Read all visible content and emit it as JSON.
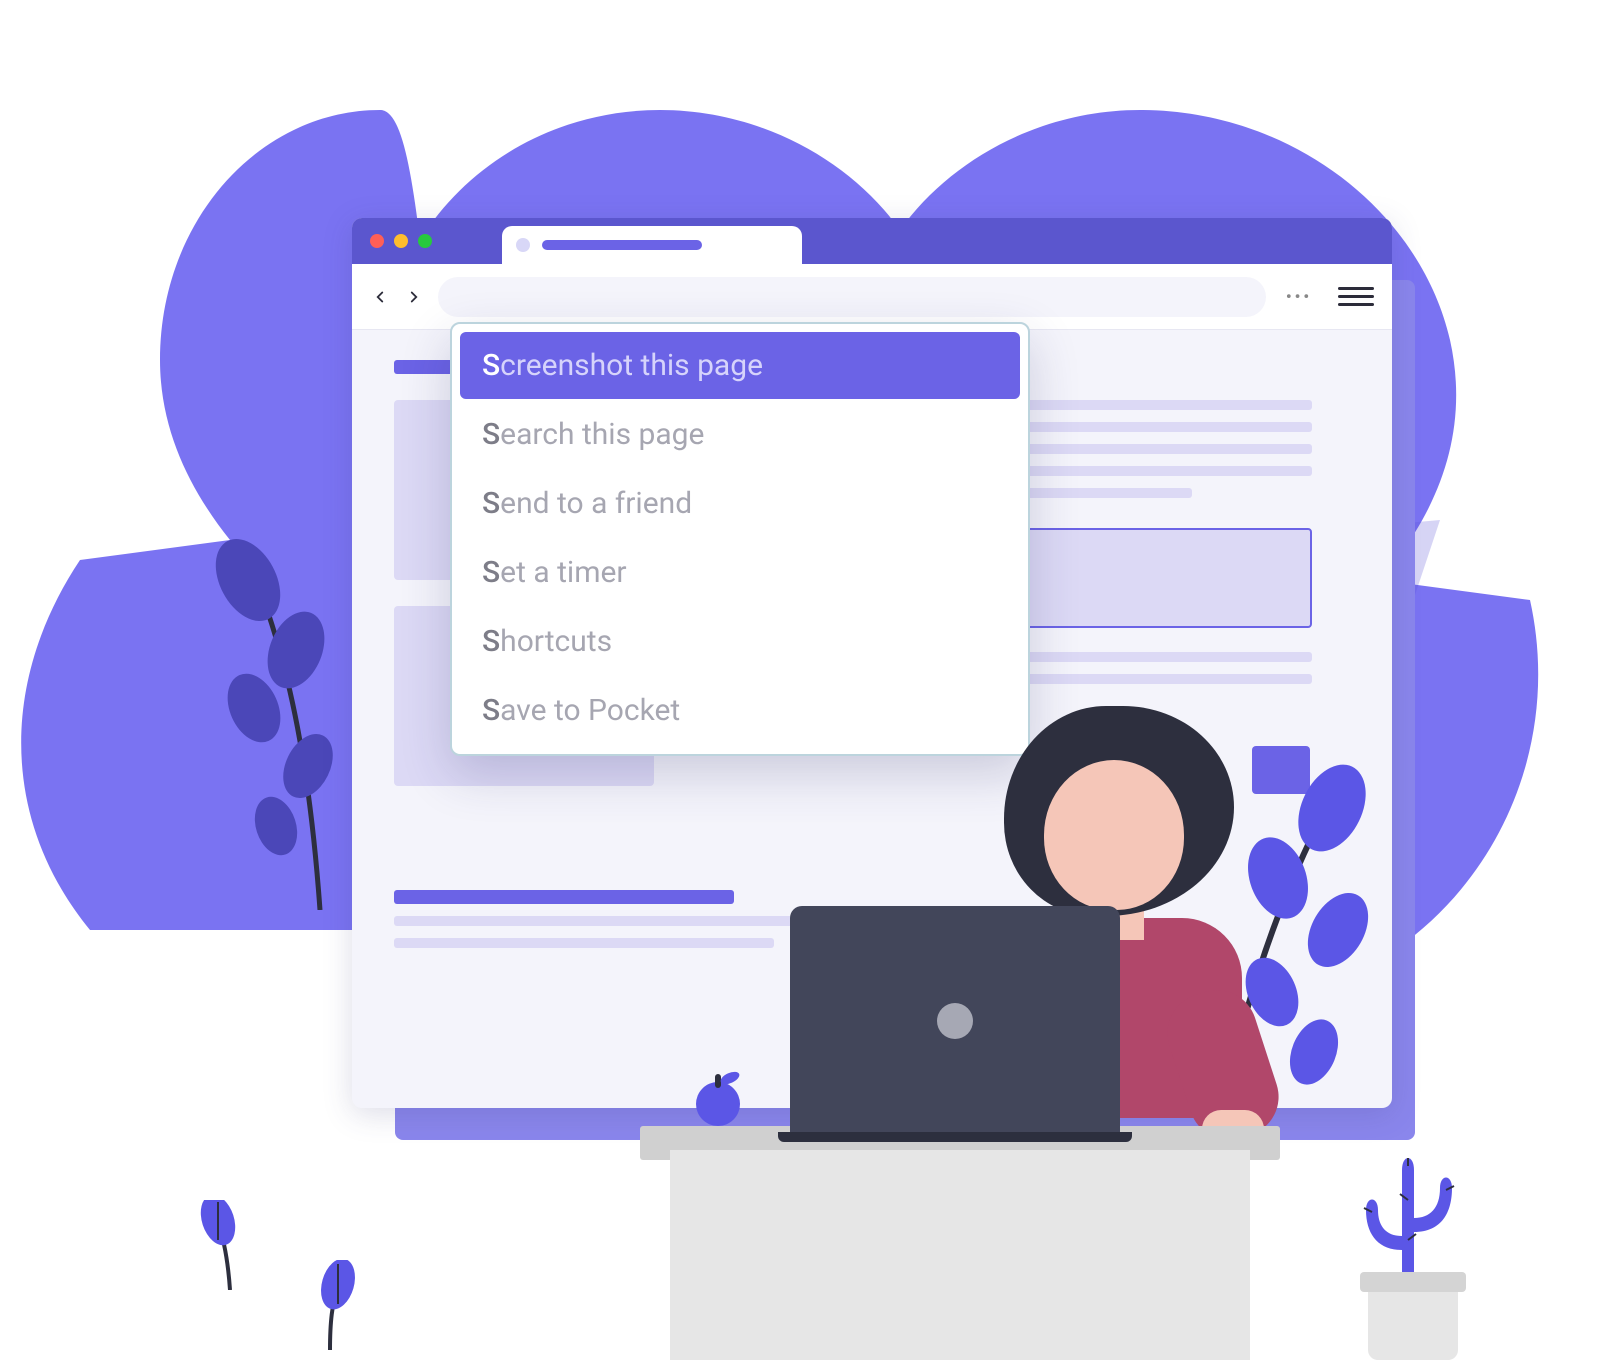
{
  "palette": {
    "items": [
      {
        "match": "S",
        "rest": "creenshot this page",
        "selected": true
      },
      {
        "match": "S",
        "rest": "earch this page",
        "selected": false
      },
      {
        "match": "S",
        "rest": "end to a friend",
        "selected": false
      },
      {
        "match": "S",
        "rest": "et a timer",
        "selected": false
      },
      {
        "match": "S",
        "rest": "hortcuts",
        "selected": false
      },
      {
        "match": "S",
        "rest": "ave to Pocket",
        "selected": false
      }
    ]
  },
  "colors": {
    "accent": "#6b63e6",
    "blob": "#7a73f2",
    "dark": "#2d2f3e",
    "shirt": "#b1476a",
    "skin": "#f5c6b8"
  }
}
